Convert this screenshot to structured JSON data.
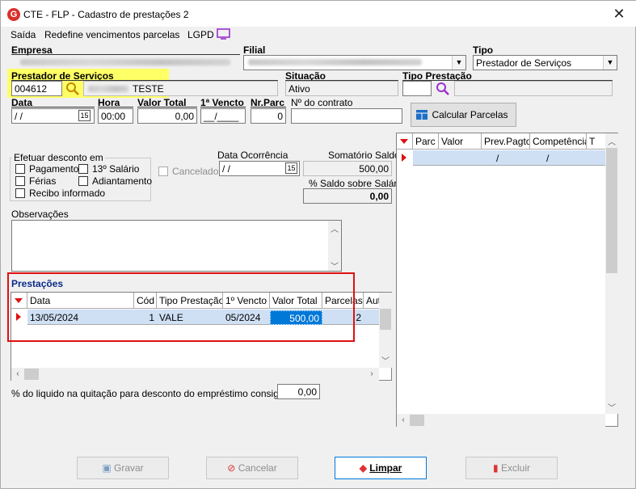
{
  "window": {
    "title": "CTE - FLP - Cadastro de prestações 2",
    "logo": "G",
    "close": "✕"
  },
  "menu": {
    "saida": "Saída",
    "redefine": "Redefine vencimentos parcelas",
    "lgpd": "LGPD"
  },
  "labels": {
    "empresa": "Empresa",
    "filial": "Filial",
    "tipo": "Tipo",
    "prestador": "Prestador de Serviços",
    "situacao": "Situação",
    "tipo_prestacao": "Tipo Prestação",
    "data": "Data",
    "hora": "Hora",
    "valor_total": "Valor Total",
    "vencto": "1ª Vencto",
    "nr_parc": "Nr.Parc",
    "contrato": "Nº do contrato",
    "efetuar": "Efetuar desconto em",
    "pagamento": "Pagamento",
    "decimo": "13º Salário",
    "ferias": "Férias",
    "adiantamento": "Adiantamento",
    "recibo": "Recibo informado",
    "cancelado": "Cancelado",
    "data_ocorrencia": "Data Ocorrência",
    "somatorio": "Somatório Saldo",
    "saldo_salario": "% Saldo sobre Salário",
    "observacoes": "Observações",
    "prestacoes": "Prestações",
    "percentual": "% do liquido na quitação para desconto do empréstimo consignado"
  },
  "values": {
    "tipo": "Prestador de Serviços",
    "prestador_code": "004612",
    "prestador_name": "TESTE",
    "situacao": "Ativo",
    "data": " / /",
    "hora": "00:00",
    "valor_total": "0,00",
    "vencto": "__/____",
    "nr_parc": "0",
    "data_ocorrencia": " / /",
    "somatorio": "500,00",
    "saldo_salario": "0,00",
    "percentual": "0,00",
    "calendar": "15"
  },
  "buttons": {
    "calcular": "Calcular Parcelas",
    "gravar": "Gravar",
    "cancelar": "Cancelar",
    "limpar": "Limpar",
    "excluir": "Excluir"
  },
  "prestacoes_grid": {
    "headers": [
      "Data",
      "Cód",
      "Tipo Prestação",
      "1º Vencto",
      "Valor Total",
      "Parcelas",
      "Auto d"
    ],
    "rows": [
      [
        "13/05/2024",
        "1",
        "VALE",
        "05/2024",
        "500,00",
        "2"
      ]
    ]
  },
  "parcelas_grid": {
    "headers": [
      "Parc",
      "Valor",
      "Prev.Pagto",
      "Competência",
      "T"
    ],
    "rows": [
      [
        "",
        "",
        "/",
        "/"
      ]
    ]
  },
  "colors": {
    "highlight": "#ffff66",
    "selection": "#0078d7",
    "red_box": "#e01010",
    "lgpd_icon": "#9b30d0"
  }
}
